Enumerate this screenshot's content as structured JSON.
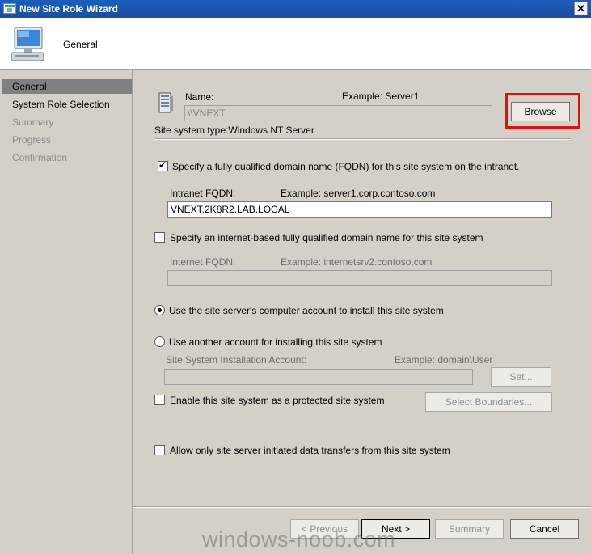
{
  "window": {
    "title": "New Site Role Wizard",
    "close_glyph": "✕"
  },
  "header": {
    "title": "General",
    "icon": "computer-icon"
  },
  "sidebar": {
    "items": [
      {
        "label": "General",
        "state": "active"
      },
      {
        "label": "System Role Selection",
        "state": "normal"
      },
      {
        "label": "Summary",
        "state": "disabled"
      },
      {
        "label": "Progress",
        "state": "disabled"
      },
      {
        "label": "Confirmation",
        "state": "disabled"
      }
    ]
  },
  "name_section": {
    "label": "Name:",
    "example": "Example: Server1",
    "value": "\\\\VNEXT",
    "browse_label": "Browse",
    "site_system_type": "Site system type:Windows NT Server",
    "highlight_color": "#e01010"
  },
  "fqdn": {
    "checkbox_label": "Specify a fully qualified domain name (FQDN) for this site system on the intranet.",
    "checked": true,
    "intranet_label": "Intranet FQDN:",
    "intranet_example": "Example: server1.corp.contoso.com",
    "intranet_value": "VNEXT.2K8R2.LAB.LOCAL"
  },
  "internet": {
    "checkbox_label": "Specify an internet-based fully qualified domain name for this site system",
    "checked": false,
    "internet_label": "Internet FQDN:",
    "internet_example": "Example: internetsrv2.contoso.com",
    "internet_value": ""
  },
  "account": {
    "radio_computer_label": "Use the site server's computer account to install this site system",
    "radio_other_label": "Use another account for installing this site system",
    "selected": "computer",
    "install_account_label": "Site System Installation Account:",
    "install_account_example": "Example: domain\\User",
    "install_account_value": "",
    "set_label": "Set..."
  },
  "protected": {
    "checkbox_label": "Enable this site system as a protected site system",
    "checked": false,
    "select_boundaries_label": "Select Boundaries..."
  },
  "transfers": {
    "checkbox_label": "Allow only site server initiated data transfers from this site system",
    "checked": false
  },
  "footer": {
    "previous_label": "< Previous",
    "next_label": "Next >",
    "summary_label": "Summary",
    "cancel_label": "Cancel"
  },
  "watermark": "windows-noob.com"
}
